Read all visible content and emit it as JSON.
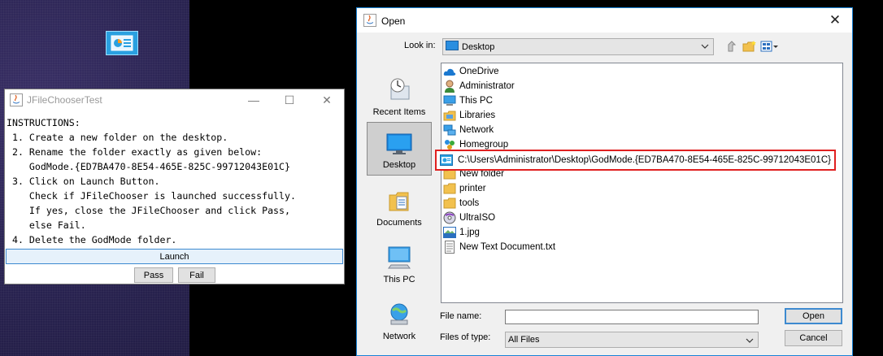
{
  "test_window": {
    "title": "JFileChooserTest",
    "instructions": [
      "INSTRUCTIONS:",
      " 1. Create a new folder on the desktop.",
      " 2. Rename the folder exactly as given below:",
      "    GodMode.{ED7BA470-8E54-465E-825C-99712043E01C}",
      " 3. Click on Launch Button.",
      "    Check if JFileChooser is launched successfully.",
      "    If yes, close the JFileChooser and click Pass,",
      "    else Fail.",
      " 4. Delete the GodMode folder."
    ],
    "launch_label": "Launch",
    "pass_label": "Pass",
    "fail_label": "Fail",
    "minimize_glyph": "—",
    "maximize_glyph": "☐",
    "close_glyph": "✕"
  },
  "open_dialog": {
    "title": "Open",
    "close_glyph": "✕",
    "look_in_label": "Look in:",
    "look_in_value": "Desktop",
    "places": [
      {
        "label": "Recent Items",
        "icon": "recent-items-icon"
      },
      {
        "label": "Desktop",
        "icon": "desktop-icon"
      },
      {
        "label": "Documents",
        "icon": "documents-icon"
      },
      {
        "label": "This PC",
        "icon": "this-pc-icon"
      },
      {
        "label": "Network",
        "icon": "network-icon"
      }
    ],
    "files": [
      {
        "name": "OneDrive",
        "icon": "onedrive-icon"
      },
      {
        "name": "Administrator",
        "icon": "user-icon"
      },
      {
        "name": "This PC",
        "icon": "computer-icon"
      },
      {
        "name": "Libraries",
        "icon": "libraries-icon"
      },
      {
        "name": "Network",
        "icon": "network-icon"
      },
      {
        "name": "Homegroup",
        "icon": "homegroup-icon"
      },
      {
        "name": "C:\\Users\\Administrator\\Desktop\\GodMode.{ED7BA470-8E54-465E-825C-99712043E01C}",
        "icon": "control-panel-icon",
        "highlighted": true
      },
      {
        "name": "New folder",
        "icon": "folder-icon"
      },
      {
        "name": "printer",
        "icon": "folder-icon"
      },
      {
        "name": "tools",
        "icon": "folder-icon"
      },
      {
        "name": "UltraISO",
        "icon": "ultraiso-icon"
      },
      {
        "name": "1.jpg",
        "icon": "jpg-file-icon"
      },
      {
        "name": "New Text Document.txt",
        "icon": "text-file-icon"
      }
    ],
    "file_name_label": "File name:",
    "file_name_value": "",
    "file_type_label": "Files of type:",
    "file_type_value": "All Files",
    "open_label": "Open",
    "cancel_label": "Cancel"
  },
  "colors": {
    "highlight_border": "#e02020",
    "accent": "#3d8ad0",
    "dialog_border": "#1883d7"
  }
}
